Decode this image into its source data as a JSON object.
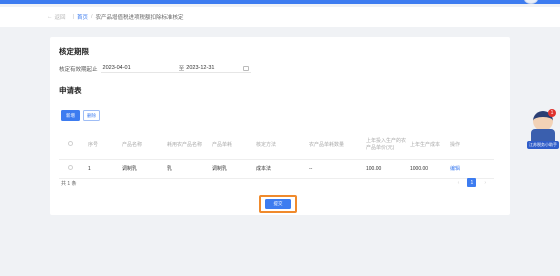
{
  "breadcrumb": {
    "back_label": "返回",
    "home": "首页",
    "current": "农产品增值税进项税额扣除标准核定"
  },
  "period_section": {
    "title": "核定期限",
    "field_label": "核定有效期起止",
    "start_date": "2023-04-01",
    "to_label": "至",
    "end_date": "2023-12-31"
  },
  "apply_section": {
    "title": "申请表",
    "add_label": "新增",
    "delete_label": "删除"
  },
  "table": {
    "headers": [
      "序号",
      "产品名称",
      "耗用农产品名称",
      "产品单耗",
      "核定方法",
      "农产品单耗数量",
      "上年投入生产的农产品单价(元)",
      "上年生产成本",
      "操作"
    ],
    "rows": [
      {
        "index": "1",
        "product": "调制乳",
        "farm_product": "乳",
        "unit_consumption": "调制乳",
        "method": "成本法",
        "quantity": "--",
        "price": "100.00",
        "cost": "1000.00",
        "op": "编辑"
      }
    ]
  },
  "footer": {
    "total": "共 1 条",
    "page": "1",
    "submit_label": "提交"
  },
  "mascot": {
    "badge": "1",
    "tag": "江苏税务小助手"
  },
  "colors": {
    "primary": "#3d7cf0",
    "highlight": "#f08a2c"
  }
}
